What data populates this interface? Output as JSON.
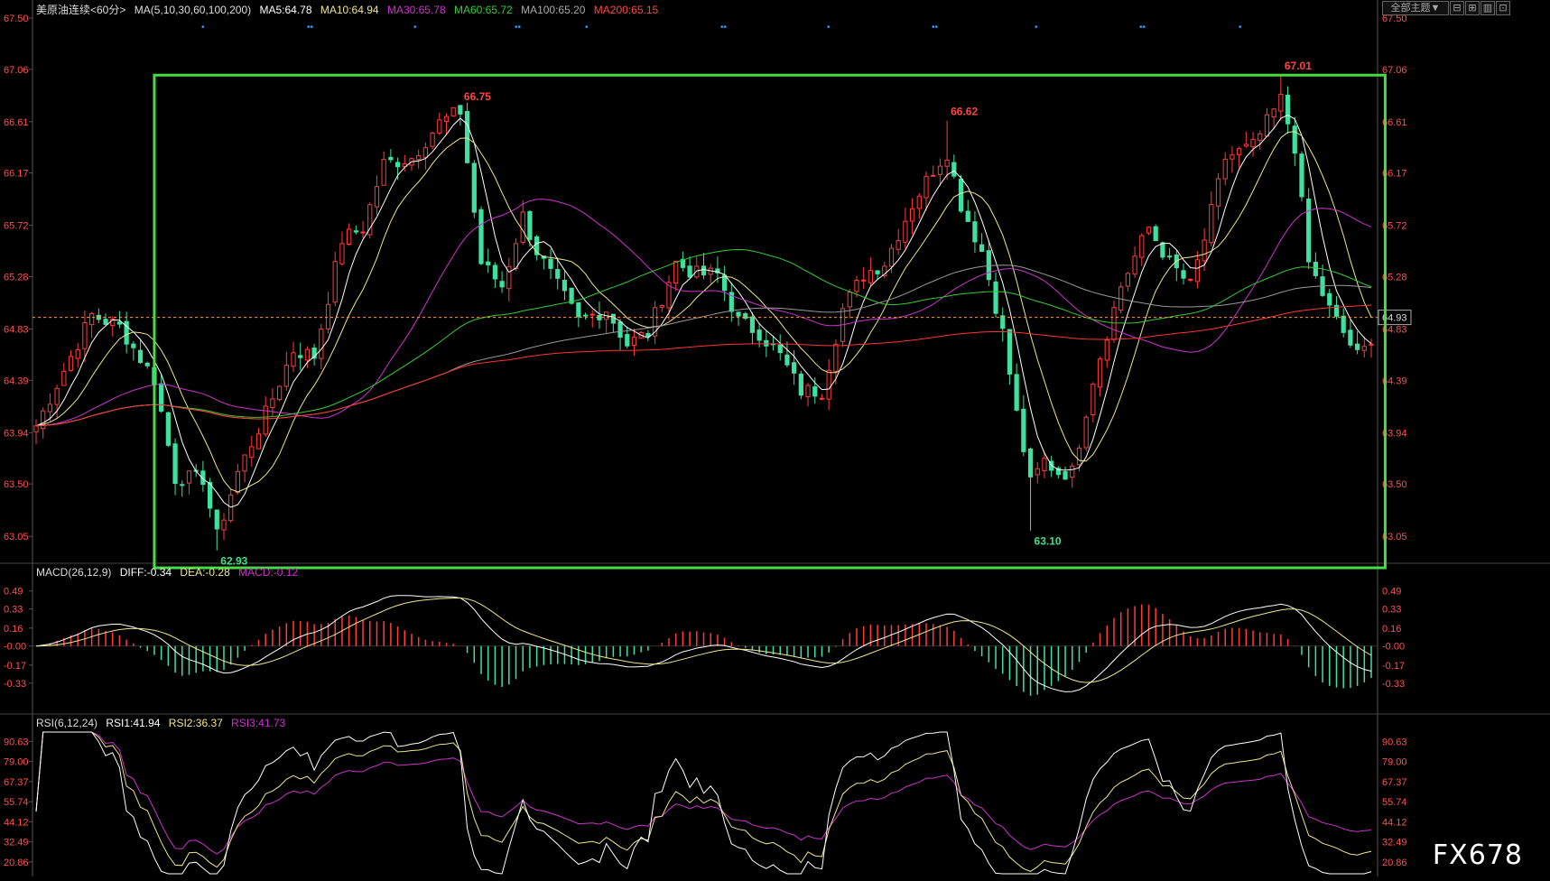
{
  "header": {
    "instrument": "美原油连续<60分>",
    "ma_group": "MA(5,10,30,60,100,200)",
    "ma5": "MA5:64.78",
    "ma10": "MA10:64.94",
    "ma30": "MA30:65.78",
    "ma60": "MA60:65.72",
    "ma100": "MA100:65.20",
    "ma200": "MA200:65.15",
    "theme_button": "全部主题▼"
  },
  "macd_header": {
    "name": "MACD(26,12,9)",
    "diff": "DIFF:-0.34",
    "dea": "DEA:-0.28",
    "macd": "MACD:-0.12"
  },
  "rsi_header": {
    "name": "RSI(6,12,24)",
    "rsi1": "RSI1:41.94",
    "rsi2": "RSI2:36.37",
    "rsi3": "RSI3:41.73"
  },
  "watermark": "FX678",
  "colors": {
    "up": "#ff3b3b",
    "down": "#3fe0a0",
    "ma5": "#ffffff",
    "ma10": "#f0e68c",
    "ma30": "#cc33cc",
    "ma60": "#33cc33",
    "ma100": "#999999",
    "ma200": "#ff3333",
    "box": "#44dd44",
    "label": "#ff4444"
  },
  "chart_data": [
    {
      "type": "candlestick",
      "ylim": [
        62.85,
        67.5
      ],
      "y_ticks": [
        "67.50",
        "67.06",
        "66.61",
        "66.17",
        "65.72",
        "65.28",
        "64.83",
        "64.39",
        "63.94",
        "63.50",
        "63.05"
      ],
      "current_price": "64.93",
      "annotations": [
        {
          "bar": 61,
          "price": 66.75,
          "text": "66.75"
        },
        {
          "bar": 26,
          "price": 62.93,
          "text": "62.93"
        },
        {
          "bar": 131,
          "price": 66.62,
          "text": "66.62"
        },
        {
          "bar": 143,
          "price": 63.1,
          "text": "63.10"
        },
        {
          "bar": 179,
          "price": 67.01,
          "text": "67.01"
        }
      ],
      "range_box": {
        "bar_start": 17,
        "bar_end": 194,
        "high": 67.01,
        "low": 62.78
      },
      "anchors": [
        [
          0,
          64.0
        ],
        [
          8,
          64.95
        ],
        [
          12,
          64.85
        ],
        [
          17,
          64.4
        ],
        [
          20,
          63.55
        ],
        [
          24,
          63.55
        ],
        [
          26,
          63.05
        ],
        [
          29,
          63.6
        ],
        [
          33,
          64.1
        ],
        [
          37,
          64.65
        ],
        [
          40,
          64.6
        ],
        [
          44,
          65.6
        ],
        [
          47,
          65.7
        ],
        [
          50,
          66.25
        ],
        [
          54,
          66.3
        ],
        [
          58,
          66.6
        ],
        [
          61,
          66.7
        ],
        [
          64,
          65.4
        ],
        [
          67,
          65.2
        ],
        [
          70,
          65.8
        ],
        [
          72,
          65.5
        ],
        [
          75,
          65.2
        ],
        [
          78,
          64.9
        ],
        [
          82,
          65.0
        ],
        [
          85,
          64.7
        ],
        [
          88,
          64.8
        ],
        [
          92,
          65.4
        ],
        [
          95,
          65.3
        ],
        [
          98,
          65.3
        ],
        [
          101,
          64.9
        ],
        [
          104,
          64.8
        ],
        [
          107,
          64.6
        ],
        [
          110,
          64.3
        ],
        [
          113,
          64.3
        ],
        [
          116,
          65.0
        ],
        [
          119,
          65.3
        ],
        [
          122,
          65.4
        ],
        [
          126,
          65.9
        ],
        [
          129,
          66.2
        ],
        [
          131,
          66.35
        ],
        [
          133,
          65.9
        ],
        [
          136,
          65.5
        ],
        [
          139,
          64.8
        ],
        [
          141,
          64.1
        ],
        [
          143,
          63.5
        ],
        [
          145,
          63.7
        ],
        [
          147,
          63.6
        ],
        [
          149,
          63.6
        ],
        [
          152,
          64.4
        ],
        [
          156,
          65.2
        ],
        [
          160,
          65.7
        ],
        [
          163,
          65.4
        ],
        [
          166,
          65.2
        ],
        [
          168,
          65.6
        ],
        [
          171,
          66.3
        ],
        [
          173,
          66.35
        ],
        [
          175,
          66.4
        ],
        [
          179,
          66.8
        ],
        [
          181,
          66.4
        ],
        [
          183,
          65.4
        ],
        [
          186,
          65.0
        ],
        [
          188,
          64.8
        ],
        [
          190,
          64.6
        ],
        [
          192,
          64.7
        ]
      ],
      "n_bars": 193
    },
    {
      "type": "macd",
      "ylim": [
        -0.5,
        0.56
      ],
      "y_ticks": [
        "0.49",
        "0.33",
        "0.16",
        "-0.00",
        "-0.17",
        "-0.33"
      ]
    },
    {
      "type": "rsi",
      "ylim": [
        14,
        96
      ],
      "y_ticks": [
        "90.63",
        "79.00",
        "67.37",
        "55.74",
        "44.12",
        "32.49",
        "20.86"
      ]
    }
  ]
}
